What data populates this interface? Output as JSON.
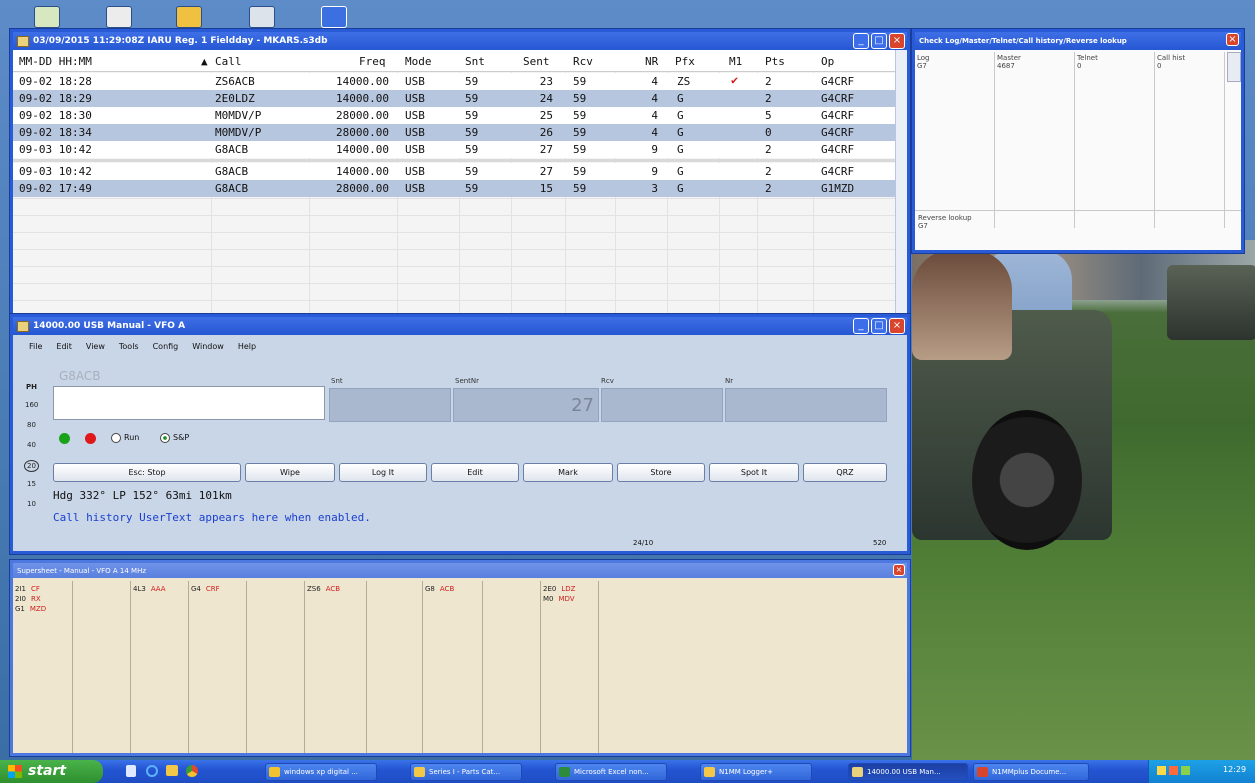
{
  "log_window": {
    "title": "03/09/2015 11:29:08Z  IARU Reg. 1 Fieldday - MKARS.s3db",
    "columns": [
      "MM-DD HH:MM",
      "Call",
      "Freq",
      "Mode",
      "Snt",
      "Sent",
      "Rcv",
      "NR",
      "Pfx",
      "M1",
      "Pts",
      "Op"
    ],
    "sort_indicator": "▲",
    "rows": [
      {
        "datetime": "09-02 18:28",
        "call": "ZS6ACB",
        "freq": "14000.00",
        "mode": "USB",
        "snt": "59",
        "sent": "23",
        "rcv": "59",
        "nr": "4",
        "pfx": "ZS",
        "m1": "✔",
        "pts": "2",
        "op": "G4CRF"
      },
      {
        "datetime": "09-02 18:29",
        "call": "2E0LDZ",
        "freq": "14000.00",
        "mode": "USB",
        "snt": "59",
        "sent": "24",
        "rcv": "59",
        "nr": "4",
        "pfx": "G",
        "m1": "",
        "pts": "2",
        "op": "G4CRF"
      },
      {
        "datetime": "09-02 18:30",
        "call": "M0MDV/P",
        "freq": "28000.00",
        "mode": "USB",
        "snt": "59",
        "sent": "25",
        "rcv": "59",
        "nr": "4",
        "pfx": "G",
        "m1": "",
        "pts": "5",
        "op": "G4CRF"
      },
      {
        "datetime": "09-02 18:34",
        "call": "M0MDV/P",
        "freq": "28000.00",
        "mode": "USB",
        "snt": "59",
        "sent": "26",
        "rcv": "59",
        "nr": "4",
        "pfx": "G",
        "m1": "",
        "pts": "0",
        "op": "G4CRF"
      },
      {
        "datetime": "09-03 10:42",
        "call": "G8ACB",
        "freq": "14000.00",
        "mode": "USB",
        "snt": "59",
        "sent": "27",
        "rcv": "59",
        "nr": "9",
        "pfx": "G",
        "m1": "",
        "pts": "2",
        "op": "G4CRF"
      }
    ],
    "lower_rows": [
      {
        "datetime": "09-03 10:42",
        "call": "G8ACB",
        "freq": "14000.00",
        "mode": "USB",
        "snt": "59",
        "sent": "27",
        "rcv": "59",
        "nr": "9",
        "pfx": "G",
        "m1": "",
        "pts": "2",
        "op": "G4CRF"
      },
      {
        "datetime": "09-02 17:49",
        "call": "G8ACB",
        "freq": "28000.00",
        "mode": "USB",
        "snt": "59",
        "sent": "15",
        "rcv": "59",
        "nr": "3",
        "pfx": "G",
        "m1": "",
        "pts": "2",
        "op": "G1MZD"
      }
    ]
  },
  "check_window": {
    "title": "Check Log/Master/Telnet/Call history/Reverse lookup",
    "panels": [
      {
        "label": "Log",
        "value": "G7"
      },
      {
        "label": "Master",
        "value": "4687"
      },
      {
        "label": "Telnet",
        "value": "0"
      },
      {
        "label": "Call hist",
        "value": "0"
      }
    ],
    "reverse_label": "Reverse lookup",
    "reverse_value": "G7"
  },
  "entry_window": {
    "title": "14000.00 USB Manual - VFO A",
    "menu": [
      "File",
      "Edit",
      "View",
      "Tools",
      "Config",
      "Window",
      "Help"
    ],
    "call_hint": "G8ACB",
    "call_value": "",
    "field_labels": [
      "Snt",
      "SentNr",
      "Rcv",
      "Nr"
    ],
    "sent_nr_value": "27",
    "bands": [
      "PH",
      "160",
      "80",
      "40",
      "20",
      "15",
      "10"
    ],
    "radio_run": "Run",
    "radio_sp": "S&P",
    "buttons": [
      "Esc: Stop",
      "Wipe",
      "Log It",
      "Edit",
      "Mark",
      "Store",
      "Spot It",
      "QRZ"
    ],
    "bearing_text": "Hdg 332° LP 152° 63mi 101km",
    "user_text": "Call history UserText appears here when enabled.",
    "status_left": "24/10",
    "status_right": "520"
  },
  "supersheet": {
    "title": "Supersheet - Manual - VFO A 14 MHz",
    "col1": [
      {
        "pfx": "2I1",
        "sfx": "CF"
      },
      {
        "pfx": "2I0",
        "sfx": "RX"
      },
      {
        "pfx": "G1",
        "sfx": "MZD"
      }
    ],
    "col3": [
      {
        "pfx": "4L3",
        "sfx": "AAA"
      }
    ],
    "col4": [
      {
        "pfx": "G4",
        "sfx": "CRF"
      }
    ],
    "col6": [
      {
        "pfx": "ZS6",
        "sfx": "ACB"
      }
    ],
    "col8": [
      {
        "pfx": "G8",
        "sfx": "ACB"
      }
    ],
    "col10": [
      {
        "pfx": "2E0",
        "sfx": "LDZ"
      },
      {
        "pfx": "M0",
        "sfx": "MDV"
      }
    ]
  },
  "taskbar": {
    "start": "start",
    "items": [
      "windows xp digital ...",
      "Series I - Parts Cat...",
      "Microsoft Excel non...",
      "N1MM Logger+",
      "14000.00 USB Man...",
      "N1MMplus Docume..."
    ],
    "clock": "12:29"
  },
  "colors": {
    "accent": "#2a5bd7",
    "row_selected": "#b7c6df",
    "red_text": "#d21c1c",
    "user_text": "#1a3fd0"
  }
}
